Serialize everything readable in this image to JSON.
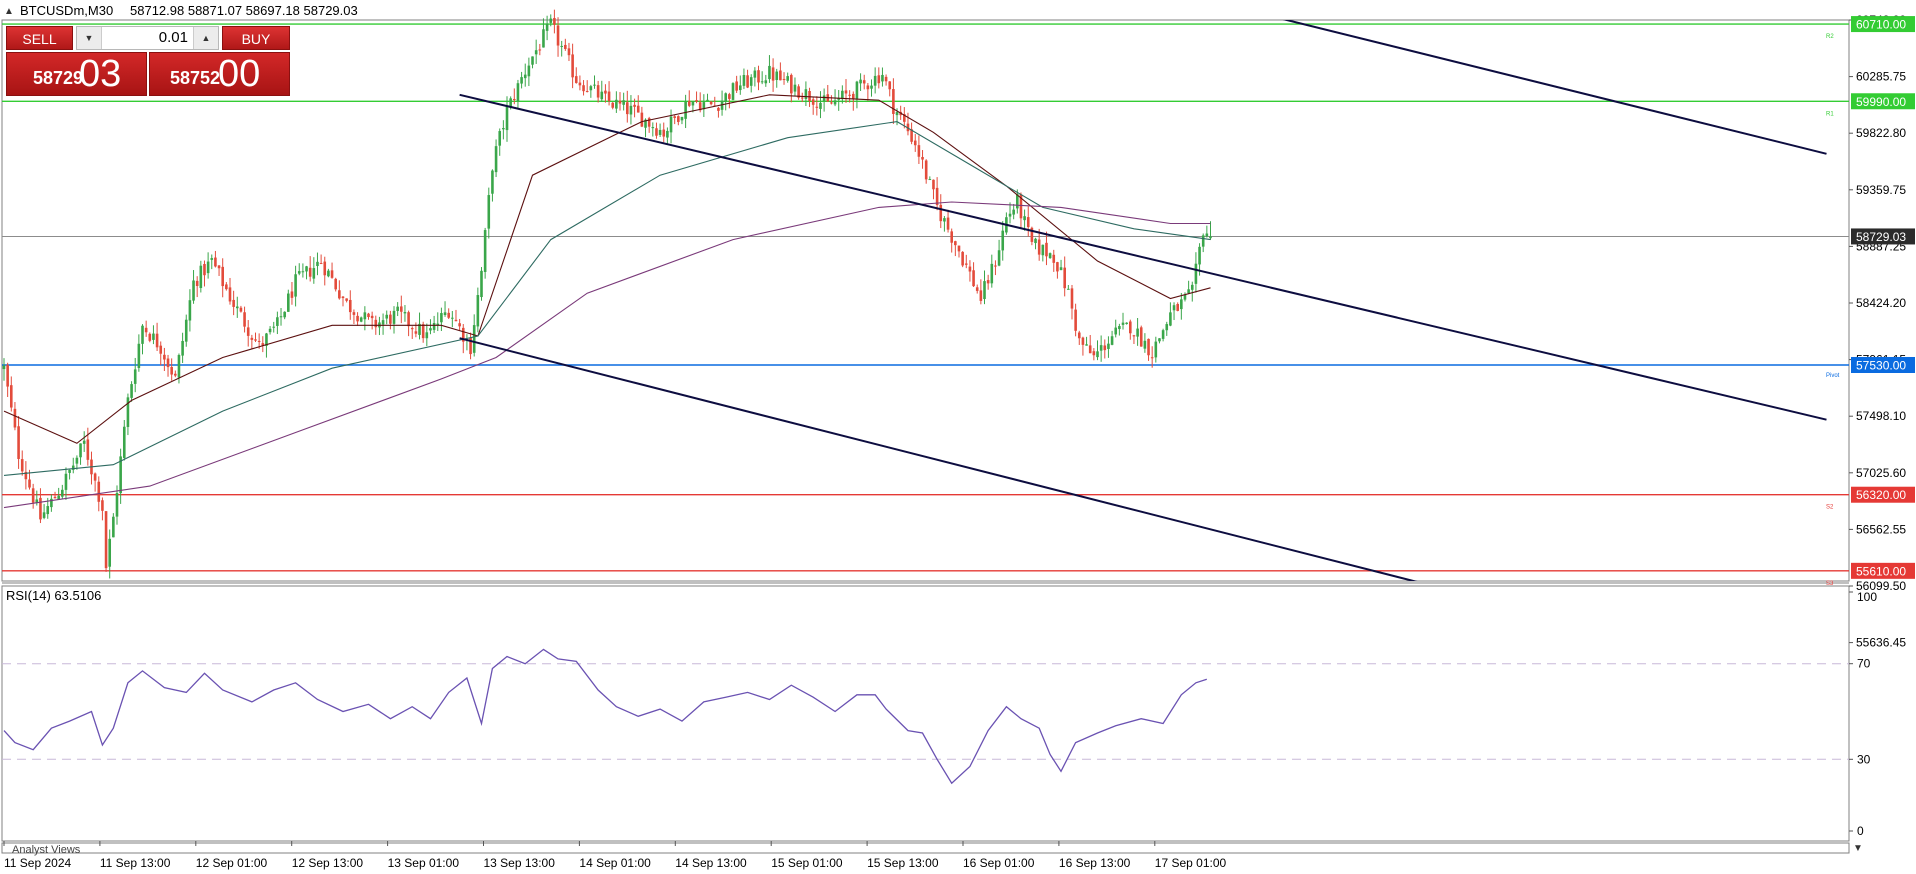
{
  "header": {
    "symbol_info": "BTCUSDm,M30",
    "ohlc": "58712.98 58871.07 58697.18 58729.03"
  },
  "trade_panel": {
    "sell_label": "SELL",
    "buy_label": "BUY",
    "lot": "0.01",
    "sell_price_small": "58729",
    "sell_price_big": "03",
    "buy_price_small": "58752",
    "buy_price_big": "00"
  },
  "price_axis": {
    "ticks": [
      "60748.00",
      "60285.75",
      "59822.80",
      "59359.75",
      "58887.25",
      "58424.20",
      "57961.15",
      "57498.10",
      "57025.60",
      "56562.55",
      "56099.50",
      "55636.45"
    ],
    "current_price": "58729.03"
  },
  "levels": [
    {
      "label": "60710.00",
      "tag": "R2",
      "color": "#33cc33"
    },
    {
      "label": "59990.00",
      "tag": "R1",
      "color": "#33cc33"
    },
    {
      "label": "57530.00",
      "tag": "Pivot",
      "color": "#0a6be0"
    },
    {
      "label": "56320.00",
      "tag": "S2",
      "color": "#e53935"
    },
    {
      "label": "55610.00",
      "tag": "S3",
      "color": "#e53935"
    }
  ],
  "rsi": {
    "label": "RSI(14) 63.5106",
    "ticks": [
      "100",
      "70",
      "30",
      "0"
    ]
  },
  "time_axis": [
    "11 Sep 2024",
    "11 Sep 13:00",
    "12 Sep 01:00",
    "12 Sep 13:00",
    "13 Sep 01:00",
    "13 Sep 13:00",
    "14 Sep 01:00",
    "14 Sep 13:00",
    "15 Sep 01:00",
    "15 Sep 13:00",
    "16 Sep 01:00",
    "16 Sep 13:00",
    "17 Sep 01:00"
  ],
  "footer_text": "Analyst Views",
  "colors": {
    "bull": "#3aa64a",
    "bear": "#e34b3b",
    "ma_dark": "#5c1010",
    "ma_teal": "#2e6b62",
    "ma_purple": "#7a3a7a",
    "rsi_line": "#6a52b2",
    "channel": "#0d0d40"
  },
  "chart_data": {
    "type": "candlestick",
    "symbol": "BTCUSDm",
    "timeframe": "M30",
    "ohlc_last": {
      "open": 58712.98,
      "high": 58871.07,
      "low": 58697.18,
      "close": 58729.03
    },
    "price_range": [
      55400,
      60900
    ],
    "close_path": [
      [
        0,
        57500
      ],
      [
        4,
        56700
      ],
      [
        10,
        56100
      ],
      [
        16,
        56400
      ],
      [
        22,
        56800
      ],
      [
        27,
        56200
      ],
      [
        28,
        55650
      ],
      [
        30,
        56100
      ],
      [
        34,
        57200
      ],
      [
        38,
        57900
      ],
      [
        43,
        57700
      ],
      [
        47,
        57400
      ],
      [
        52,
        58300
      ],
      [
        57,
        58500
      ],
      [
        63,
        58100
      ],
      [
        70,
        57700
      ],
      [
        75,
        57900
      ],
      [
        80,
        58300
      ],
      [
        87,
        58500
      ],
      [
        94,
        58100
      ],
      [
        101,
        57900
      ],
      [
        108,
        58000
      ],
      [
        116,
        57800
      ],
      [
        122,
        58050
      ],
      [
        128,
        57700
      ],
      [
        131,
        58400
      ],
      [
        134,
        59400
      ],
      [
        138,
        59900
      ],
      [
        144,
        60350
      ],
      [
        150,
        60700
      ],
      [
        157,
        60200
      ],
      [
        165,
        60000
      ],
      [
        172,
        59900
      ],
      [
        181,
        59700
      ],
      [
        188,
        60000
      ],
      [
        195,
        59950
      ],
      [
        202,
        60150
      ],
      [
        210,
        60250
      ],
      [
        218,
        60100
      ],
      [
        226,
        59950
      ],
      [
        234,
        60100
      ],
      [
        241,
        60250
      ],
      [
        244,
        59950
      ],
      [
        250,
        59600
      ],
      [
        256,
        59000
      ],
      [
        262,
        58600
      ],
      [
        268,
        58150
      ],
      [
        272,
        58500
      ],
      [
        275,
        58900
      ],
      [
        278,
        59050
      ],
      [
        282,
        58650
      ],
      [
        288,
        58550
      ],
      [
        292,
        58200
      ],
      [
        295,
        57750
      ],
      [
        299,
        57600
      ],
      [
        304,
        57800
      ],
      [
        309,
        57900
      ],
      [
        315,
        57650
      ],
      [
        320,
        58000
      ],
      [
        326,
        58200
      ],
      [
        329,
        58800
      ],
      [
        331,
        58729
      ]
    ],
    "moving_averages": [
      {
        "color": "#5c1010",
        "path": [
          [
            0,
            57100
          ],
          [
            20,
            56800
          ],
          [
            35,
            57200
          ],
          [
            60,
            57600
          ],
          [
            90,
            57900
          ],
          [
            120,
            57900
          ],
          [
            130,
            57800
          ],
          [
            145,
            59300
          ],
          [
            175,
            59800
          ],
          [
            210,
            60050
          ],
          [
            240,
            60000
          ],
          [
            255,
            59700
          ],
          [
            275,
            59200
          ],
          [
            300,
            58500
          ],
          [
            320,
            58150
          ],
          [
            331,
            58250
          ]
        ]
      },
      {
        "color": "#2e6b62",
        "path": [
          [
            0,
            56500
          ],
          [
            30,
            56600
          ],
          [
            60,
            57100
          ],
          [
            90,
            57500
          ],
          [
            130,
            57800
          ],
          [
            150,
            58700
          ],
          [
            180,
            59300
          ],
          [
            215,
            59650
          ],
          [
            245,
            59800
          ],
          [
            265,
            59400
          ],
          [
            285,
            59000
          ],
          [
            310,
            58800
          ],
          [
            331,
            58700
          ]
        ]
      },
      {
        "color": "#7a3a7a",
        "path": [
          [
            0,
            56200
          ],
          [
            40,
            56400
          ],
          [
            80,
            56900
          ],
          [
            120,
            57400
          ],
          [
            135,
            57600
          ],
          [
            160,
            58200
          ],
          [
            200,
            58700
          ],
          [
            240,
            59000
          ],
          [
            260,
            59050
          ],
          [
            290,
            59000
          ],
          [
            320,
            58850
          ],
          [
            331,
            58850
          ]
        ]
      }
    ],
    "horizontal_levels": [
      {
        "price": 60710.0,
        "label": "R2"
      },
      {
        "price": 59990.0,
        "label": "R1"
      },
      {
        "price": 57530.0,
        "label": "Pivot"
      },
      {
        "price": 56320.0,
        "label": "S2"
      },
      {
        "price": 55610.0,
        "label": "S3"
      }
    ],
    "trendlines": [
      {
        "from": [
          125,
          60050
        ],
        "to": [
          500,
          57020
        ]
      },
      {
        "from": [
          125,
          57780
        ],
        "to": [
          400,
          55400
        ]
      },
      {
        "from": [
          322,
          61000
        ],
        "to": [
          500,
          59500
        ]
      }
    ],
    "rsi": {
      "period": 14,
      "value": 63.5106,
      "ylim": [
        0,
        100
      ],
      "levels": [
        30,
        70
      ],
      "path": [
        [
          0,
          42
        ],
        [
          3,
          37
        ],
        [
          8,
          34
        ],
        [
          13,
          43
        ],
        [
          18,
          46
        ],
        [
          24,
          50
        ],
        [
          27,
          36
        ],
        [
          30,
          43
        ],
        [
          34,
          62
        ],
        [
          38,
          67
        ],
        [
          44,
          60
        ],
        [
          50,
          58
        ],
        [
          55,
          66
        ],
        [
          60,
          59
        ],
        [
          68,
          54
        ],
        [
          74,
          59
        ],
        [
          80,
          62
        ],
        [
          86,
          55
        ],
        [
          93,
          50
        ],
        [
          100,
          53
        ],
        [
          106,
          47
        ],
        [
          112,
          52
        ],
        [
          117,
          47
        ],
        [
          122,
          58
        ],
        [
          127,
          64
        ],
        [
          131,
          45
        ],
        [
          134,
          68
        ],
        [
          138,
          73
        ],
        [
          143,
          70
        ],
        [
          148,
          76
        ],
        [
          152,
          72
        ],
        [
          157,
          71
        ],
        [
          163,
          59
        ],
        [
          168,
          52
        ],
        [
          174,
          48
        ],
        [
          180,
          51
        ],
        [
          186,
          46
        ],
        [
          192,
          54
        ],
        [
          198,
          56
        ],
        [
          204,
          58
        ],
        [
          210,
          55
        ],
        [
          216,
          61
        ],
        [
          222,
          56
        ],
        [
          228,
          50
        ],
        [
          234,
          57
        ],
        [
          239,
          57
        ],
        [
          242,
          51
        ],
        [
          248,
          42
        ],
        [
          252,
          41
        ],
        [
          256,
          30
        ],
        [
          260,
          20
        ],
        [
          265,
          27
        ],
        [
          270,
          42
        ],
        [
          275,
          52
        ],
        [
          279,
          47
        ],
        [
          284,
          43
        ],
        [
          287,
          32
        ],
        [
          290,
          25
        ],
        [
          294,
          37
        ],
        [
          300,
          41
        ],
        [
          305,
          44
        ],
        [
          312,
          47
        ],
        [
          318,
          45
        ],
        [
          323,
          57
        ],
        [
          327,
          62
        ],
        [
          330,
          63.5
        ]
      ]
    }
  }
}
